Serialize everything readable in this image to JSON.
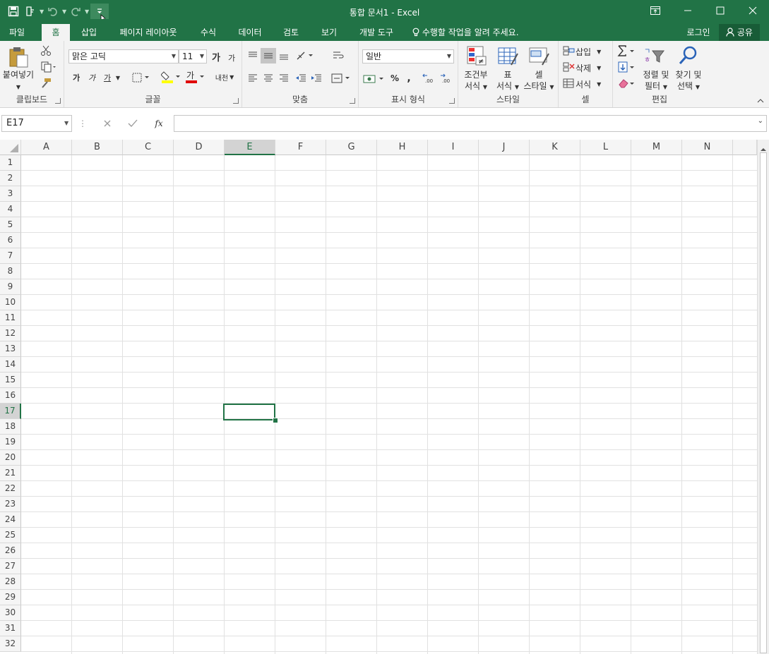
{
  "window": {
    "title": "통합 문서1 - Excel",
    "minimize_icon": "minimize-icon",
    "maximize_icon": "maximize-icon",
    "close_icon": "close-icon",
    "ribbon_display_icon": "ribbon-display-options-icon"
  },
  "qat": {
    "save_icon": "save-icon",
    "touch_mode_icon": "touch-mode-icon",
    "undo_icon": "undo-icon",
    "redo_icon": "redo-icon",
    "customize_icon": "customize-qat-icon"
  },
  "tabs": [
    {
      "label": "파일"
    },
    {
      "label": "홈"
    },
    {
      "label": "삽입"
    },
    {
      "label": "페이지 레이아웃"
    },
    {
      "label": "수식"
    },
    {
      "label": "데이터"
    },
    {
      "label": "검토"
    },
    {
      "label": "보기"
    },
    {
      "label": "개발 도구"
    }
  ],
  "tell_me": "수행할 작업을 알려 주세요.",
  "signin": "로그인",
  "share": "공유",
  "groups": {
    "clipboard": "클립보드",
    "font": "글꼴",
    "alignment": "맞춤",
    "number": "표시 형식",
    "styles": "스타일",
    "cells": "셀",
    "editing": "편집"
  },
  "clipboard": {
    "paste": "붙여넣기"
  },
  "font": {
    "name": "맑은 고딕",
    "size": "11",
    "bold": "가",
    "italic": "가",
    "underline": "가",
    "grow": "가",
    "shrink": "가",
    "font_color": "가",
    "phonetic": "내천"
  },
  "number": {
    "format": "일반",
    "percent": "%",
    "comma": ","
  },
  "styles": {
    "conditional_l1": "조건부",
    "conditional_l2": "서식",
    "table_l1": "표",
    "table_l2": "서식",
    "cell_l1": "셀",
    "cell_l2": "스타일"
  },
  "cells": {
    "insert": "삽입",
    "delete": "삭제",
    "format": "서식"
  },
  "editing": {
    "sort_l1": "정렬 및",
    "sort_l2": "필터",
    "find_l1": "찾기 및",
    "find_l2": "선택"
  },
  "formula_bar": {
    "name_box": "E17",
    "fx": "fx",
    "value": ""
  },
  "columns": [
    "A",
    "B",
    "C",
    "D",
    "E",
    "F",
    "G",
    "H",
    "I",
    "J",
    "K",
    "L",
    "M",
    "N"
  ],
  "rows": [
    "1",
    "2",
    "3",
    "4",
    "5",
    "6",
    "7",
    "8",
    "9",
    "10",
    "11",
    "12",
    "13",
    "14",
    "15",
    "16",
    "17",
    "18",
    "19",
    "20",
    "21",
    "22",
    "23",
    "24",
    "25",
    "26",
    "27",
    "28",
    "29",
    "30",
    "31",
    "32"
  ],
  "selection": {
    "column": "E",
    "row": "17"
  },
  "colors": {
    "accent": "#217346"
  }
}
